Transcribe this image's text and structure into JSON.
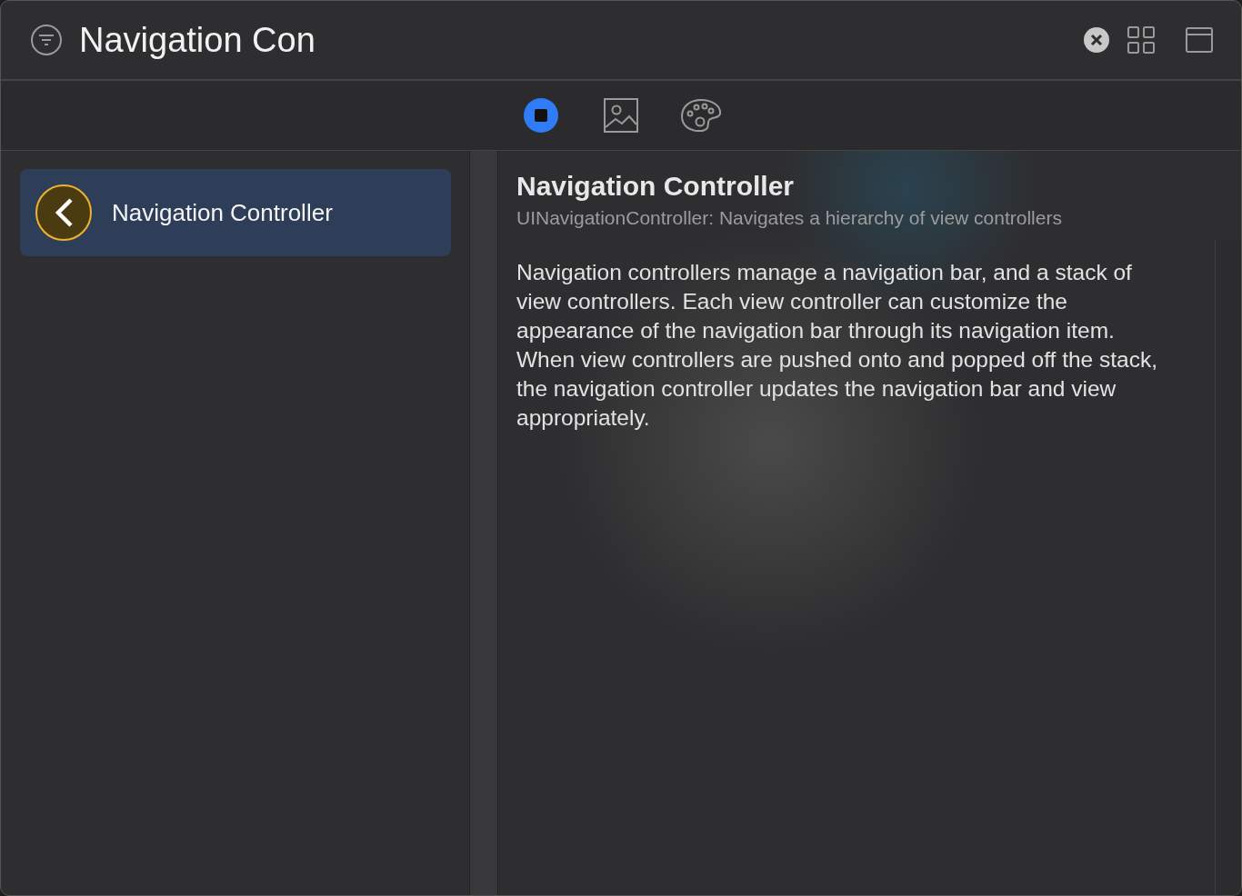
{
  "search": {
    "value": "Navigation Con"
  },
  "tabs": [
    {
      "kind": "objects",
      "selected": true
    },
    {
      "kind": "media",
      "selected": false
    },
    {
      "kind": "colors",
      "selected": false
    }
  ],
  "results": [
    {
      "title": "Navigation Controller",
      "selected": true
    }
  ],
  "detail": {
    "title": "Navigation Controller",
    "subtitle": "UINavigationController: Navigates a hierarchy of view controllers",
    "description": "Navigation controllers manage a navigation bar, and a stack of view controllers. Each view controller can customize the appearance of the navigation bar through its navigation item. When view controllers are pushed onto and popped off the stack, the navigation controller updates the navigation bar and view appropriately."
  }
}
